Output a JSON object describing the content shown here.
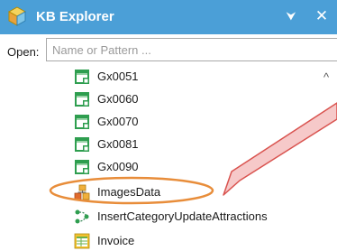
{
  "window": {
    "title": "KB Explorer",
    "pin_glyph": "⮟",
    "close_glyph": "✕",
    "title_icon": "kb-explorer-icon"
  },
  "open": {
    "label": "Open:",
    "placeholder": "Name or Pattern ..."
  },
  "tree": {
    "items": [
      {
        "label": "Gx0051",
        "icon": "table-gx-icon"
      },
      {
        "label": "Gx0060",
        "icon": "table-gx-icon"
      },
      {
        "label": "Gx0070",
        "icon": "table-gx-icon"
      },
      {
        "label": "Gx0081",
        "icon": "table-gx-icon"
      },
      {
        "label": "Gx0090",
        "icon": "table-gx-icon"
      },
      {
        "label": "ImagesData",
        "icon": "sdt-icon",
        "highlighted": true
      },
      {
        "label": "InsertCategoryUpdateAttractions",
        "icon": "procedure-icon"
      },
      {
        "label": "Invoice",
        "icon": "transaction-icon"
      }
    ]
  },
  "scrollbar": {
    "up_glyph": "^"
  },
  "colors": {
    "titlebar": "#4b9fd7",
    "highlight_ellipse": "#e88d3a",
    "arrow_fill": "#f6c9c9",
    "arrow_stroke": "#d9534f"
  }
}
